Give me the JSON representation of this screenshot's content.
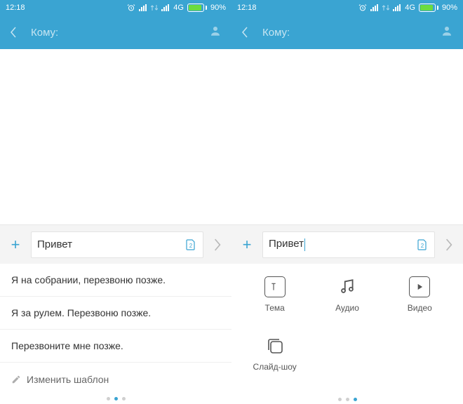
{
  "status": {
    "time": "12:18",
    "net": "4G",
    "batt_pct": "90%",
    "batt_fill": 90
  },
  "header": {
    "to_label": "Кому:"
  },
  "compose": {
    "text": "Привет"
  },
  "quick_replies": {
    "items": [
      "Я на собрании, перезвоню позже.",
      "Я за рулем. Перезвоню позже.",
      "Перезвоните мне позже."
    ],
    "edit_label": "Изменить шаблон"
  },
  "media": {
    "theme": "Тема",
    "audio": "Аудио",
    "video": "Видео",
    "slideshow": "Слайд-шоу"
  }
}
